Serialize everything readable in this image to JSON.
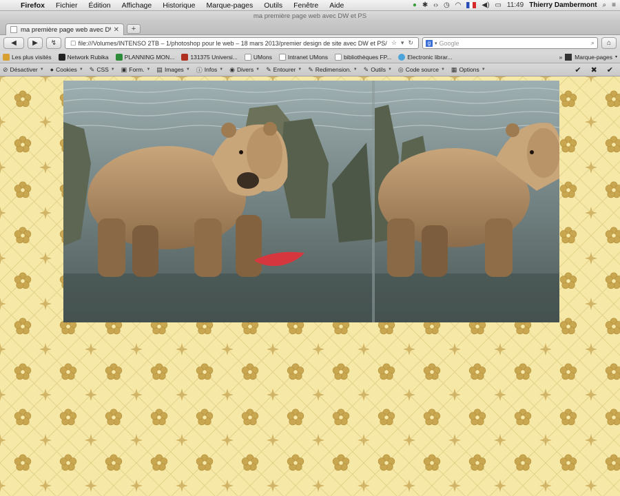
{
  "menubar": {
    "app": "Firefox",
    "items": [
      "Fichier",
      "Édition",
      "Affichage",
      "Historique",
      "Marque-pages",
      "Outils",
      "Fenêtre",
      "Aide"
    ],
    "clock": "11:49",
    "user": "Thierry Dambermont"
  },
  "window": {
    "title": "ma première page web avec DW et PS"
  },
  "tabs": [
    {
      "label": "ma première page web avec DW..."
    }
  ],
  "nav": {
    "url": "file:///Volumes/INTENSO 2TB – 1/photoshop pour le web – 18 mars 2013/premier design de site avec DW et PS/",
    "search_placeholder": "Google"
  },
  "bookmarks": {
    "items": [
      {
        "label": "Les plus visités",
        "color": "#d8a030"
      },
      {
        "label": "Network Rubika",
        "color": "#222222"
      },
      {
        "label": "PLANNING MON...",
        "color": "#2e8b3a"
      },
      {
        "label": "131375 Universi...",
        "color": "#b03020"
      },
      {
        "label": "UMons",
        "color": "#ffffff"
      },
      {
        "label": "Intranet UMons",
        "color": "#ffffff"
      },
      {
        "label": "bibliothèques FP...",
        "color": "#ffffff"
      },
      {
        "label": "Electronic librar...",
        "color": "#4ba3d9"
      }
    ],
    "right_label": "Marque-pages"
  },
  "devbar": {
    "items": [
      "Désactiver",
      "Cookies",
      "CSS",
      "Form.",
      "Images",
      "Infos",
      "Divers",
      "Entourer",
      "Redimension.",
      "Outils",
      "Code source",
      "Options"
    ]
  },
  "page": {
    "photo_alt": "brown bear standing in river holding a red salmon"
  }
}
